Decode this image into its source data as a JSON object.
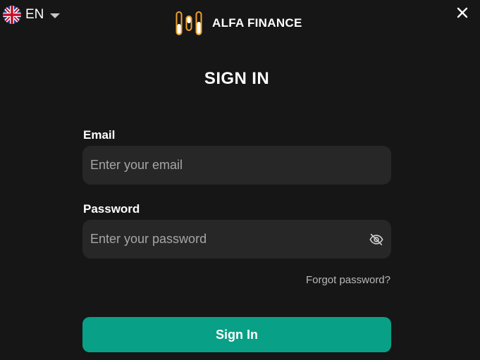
{
  "language": {
    "code": "EN",
    "flag_icon": "uk-flag-icon",
    "caret_icon": "caret-down-icon"
  },
  "close_icon": "close-icon",
  "brand": {
    "name": "ALFA FINANCE",
    "logo_icon": "alfa-finance-logo-icon",
    "accent_color": "#f0a12a"
  },
  "title": "SIGN IN",
  "form": {
    "email": {
      "label": "Email",
      "placeholder": "Enter your email",
      "value": ""
    },
    "password": {
      "label": "Password",
      "placeholder": "Enter your password",
      "value": "",
      "visibility_icon": "eye-off-icon"
    },
    "forgot_link": "Forgot password?",
    "submit_label": "Sign In"
  },
  "colors": {
    "background": "#161616",
    "input_background": "#272727",
    "primary_button": "#08a086"
  }
}
